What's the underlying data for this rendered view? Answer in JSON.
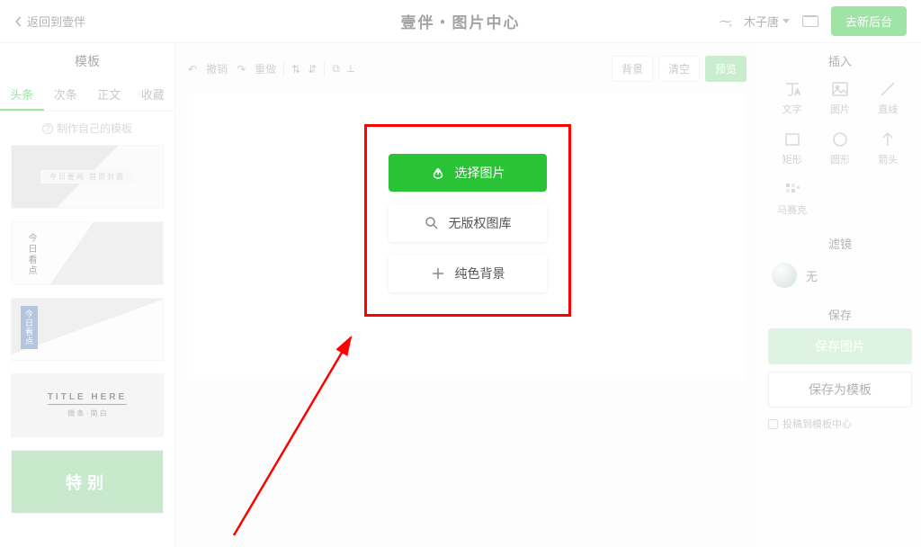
{
  "header": {
    "back_label": "返回到壹伴",
    "app_title": "壹伴・图片中心",
    "username": "木子唐",
    "go_backend": "去新后台"
  },
  "left": {
    "title": "模板",
    "tabs": [
      "头条",
      "次条",
      "正文",
      "收藏"
    ],
    "make_own": "制作自己的模板",
    "tpl1_text": "今日要闻  首页封面",
    "tpl2_text": "今日看点",
    "tpl3_text": "今日看点",
    "tpl4_title": "TITLE HERE",
    "tpl4_sub": "微 条 · 简 白",
    "tpl5_text": "特别"
  },
  "toolbar": {
    "undo": "撤销",
    "redo": "重做",
    "bg": "背景",
    "clear": "清空",
    "preview": "预览"
  },
  "canvas": {
    "select_image": "选择图片",
    "stock_library": "无版权图库",
    "solid_bg": "纯色背景"
  },
  "right": {
    "insert_title": "插入",
    "items": [
      {
        "label": "文字",
        "icon": "text"
      },
      {
        "label": "图片",
        "icon": "image"
      },
      {
        "label": "直线",
        "icon": "line"
      },
      {
        "label": "矩形",
        "icon": "rect"
      },
      {
        "label": "圆形",
        "icon": "circle"
      },
      {
        "label": "箭头",
        "icon": "arrow"
      },
      {
        "label": "马赛克",
        "icon": "mosaic"
      }
    ],
    "filter_title": "滤镜",
    "filter_none": "无",
    "save_title": "保存",
    "save_image": "保存图片",
    "save_template": "保存为模板",
    "submit_center": "投稿到模板中心"
  }
}
